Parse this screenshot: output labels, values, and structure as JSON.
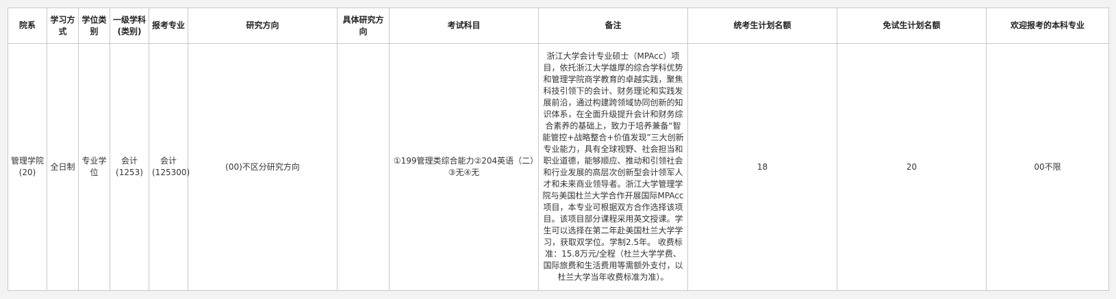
{
  "table": {
    "headers": [
      "院系",
      "学习方式",
      "学位类别",
      "一级学科(类别)",
      "报考专业",
      "研究方向",
      "具体研究方向",
      "考试科目",
      "备注",
      "统考生计划名额",
      "免试生计划名额",
      "欢迎报考的本科专业"
    ],
    "row": {
      "department": "管理学院(20)",
      "study_mode": "全日制",
      "degree_type": "专业学位",
      "discipline": "会计(1253)",
      "major": "会计(125300)",
      "research_direction": "(00)不区分研究方向",
      "specific_direction": "",
      "exam_subjects": "①199管理类综合能力②204英语（二）③无④无",
      "note": "浙江大学会计专业硕士（MPAcc）项目，依托浙江大学雄厚的综合学科优势和管理学院商学教育的卓越实践，聚焦科技引领下的会计、财务理论和实践发展前沿，通过构建跨领域协同创新的知识体系，在全面升级提升会计和财务综合素养的基础上，致力于培养兼备“智能管控+战略整合+价值发现”三大创新专业能力，具有全球视野、社会担当和职业道德，能够顺应、推动和引领社会和行业发展的高层次创新型会计领军人才和未来商业领导者。浙江大学管理学院与美国杜兰大学合作开展国际MPAcc项目，本专业可根据双方合作选择该项目。该项目部分课程采用英文授课。学生可以选择在第二年赴美国杜兰大学学习，获取双学位。学制2.5年。 收费标准：15.8万元/全程（杜兰大学学费、国际旅费和生活费用等需额外支付，以杜兰大学当年收费标准为准）。",
      "unified_quota": "18",
      "exempt_quota": "20",
      "welcome_majors": "00不限"
    }
  }
}
